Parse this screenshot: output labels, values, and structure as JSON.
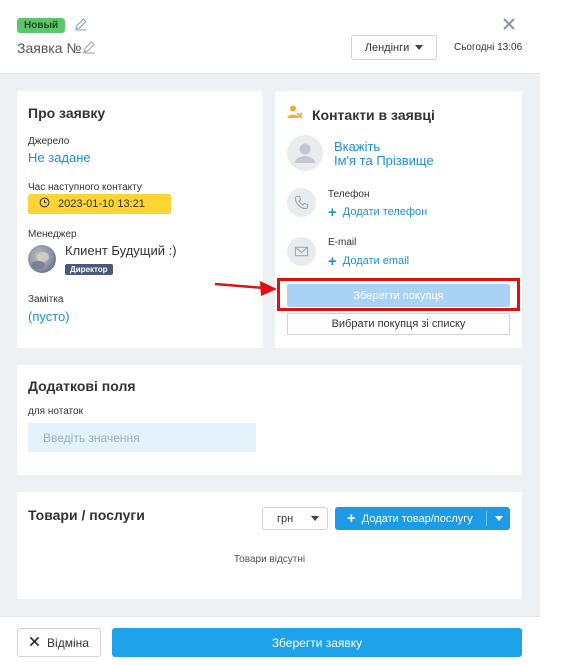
{
  "header": {
    "status_badge": "Новый",
    "title": "Заявка №",
    "landing_label": "Лендінги",
    "timestamp": "Сьогодні 13:06"
  },
  "about": {
    "title": "Про заявку",
    "source_label": "Джерело",
    "source_value": "Не задане",
    "next_contact_label": "Час наступного контакту",
    "next_contact_value": "2023-01-10 13:21",
    "manager_label": "Менеджер",
    "manager_name": "Клиент Будущий :)",
    "manager_role": "Директор",
    "note_label": "Замітка",
    "note_value": "(пусто)"
  },
  "contacts": {
    "title": "Контакти в заявці",
    "name_prompt_line1": "Вкажіть",
    "name_prompt_line2": "Ім'я та Прізвище",
    "phone_label": "Телефон",
    "add_phone": "Додати телефон",
    "email_label": "E-mail",
    "add_email": "Додати email",
    "save_buyer": "Зберегти покупця",
    "choose_buyer": "Вибрати покупця зі списку"
  },
  "extra_fields": {
    "title": "Додаткові поля",
    "notes_label": "для нотаток",
    "notes_placeholder": "Введіть значення"
  },
  "products": {
    "title": "Товари / послуги",
    "currency": "грн",
    "add_product": "Додати товар/послугу",
    "empty_text": "Товари відсутні"
  },
  "footer": {
    "cancel_label": "Відміна",
    "save_label": "Зберегти заявку"
  },
  "colors": {
    "accent": "#1e9be6",
    "badge_new": "#5cc66c",
    "date_highlight": "#fcd535",
    "annotation_red": "#e01010"
  }
}
